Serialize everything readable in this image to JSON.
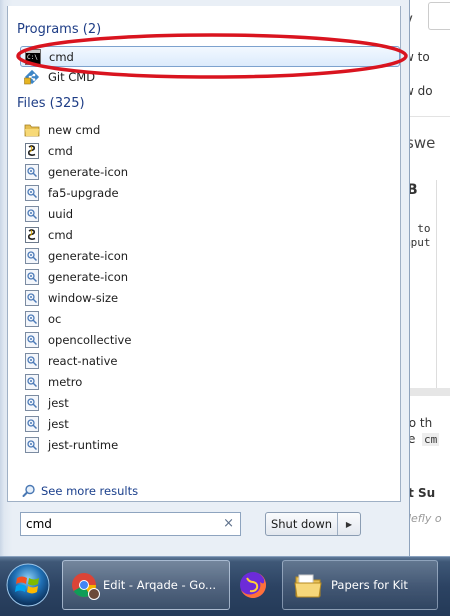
{
  "background": {
    "fragments": [
      "v",
      "w to",
      "w do",
      "swe",
      "B",
      "o to",
      "mput",
      "to th",
      "e",
      "cm",
      "it Su",
      "defly o"
    ]
  },
  "start_menu": {
    "programs": {
      "header": "Programs (2)",
      "items": [
        {
          "label": "cmd",
          "icon": "cmd-icon",
          "selected": true
        },
        {
          "label": "Git CMD",
          "icon": "git-icon",
          "selected": false
        }
      ]
    },
    "files": {
      "header": "Files (325)",
      "items": [
        {
          "label": "new cmd",
          "icon": "folder-icon"
        },
        {
          "label": "cmd",
          "icon": "batch-file-icon"
        },
        {
          "label": "generate-icon",
          "icon": "script-file-icon"
        },
        {
          "label": "fa5-upgrade",
          "icon": "script-file-icon"
        },
        {
          "label": "uuid",
          "icon": "script-file-icon"
        },
        {
          "label": "cmd",
          "icon": "batch-file-icon"
        },
        {
          "label": "generate-icon",
          "icon": "script-file-icon"
        },
        {
          "label": "generate-icon",
          "icon": "script-file-icon"
        },
        {
          "label": "window-size",
          "icon": "script-file-icon"
        },
        {
          "label": "oc",
          "icon": "script-file-icon"
        },
        {
          "label": "opencollective",
          "icon": "script-file-icon"
        },
        {
          "label": "react-native",
          "icon": "script-file-icon"
        },
        {
          "label": "metro",
          "icon": "script-file-icon"
        },
        {
          "label": "jest",
          "icon": "script-file-icon"
        },
        {
          "label": "jest",
          "icon": "script-file-icon"
        },
        {
          "label": "jest-runtime",
          "icon": "script-file-icon"
        }
      ]
    },
    "see_more": "See more results",
    "search": {
      "value": "cmd",
      "clear_glyph": "×"
    },
    "shutdown": {
      "label": "Shut down",
      "arrow_glyph": "▶"
    }
  },
  "annotation": {
    "color": "#d9141f"
  },
  "taskbar": {
    "chrome_label": "Edit - Arqade - Go...",
    "explorer_label": "Papers for Kit"
  },
  "colors": {
    "accent": "#1e3d86",
    "selection_border": "#7da2ce"
  }
}
